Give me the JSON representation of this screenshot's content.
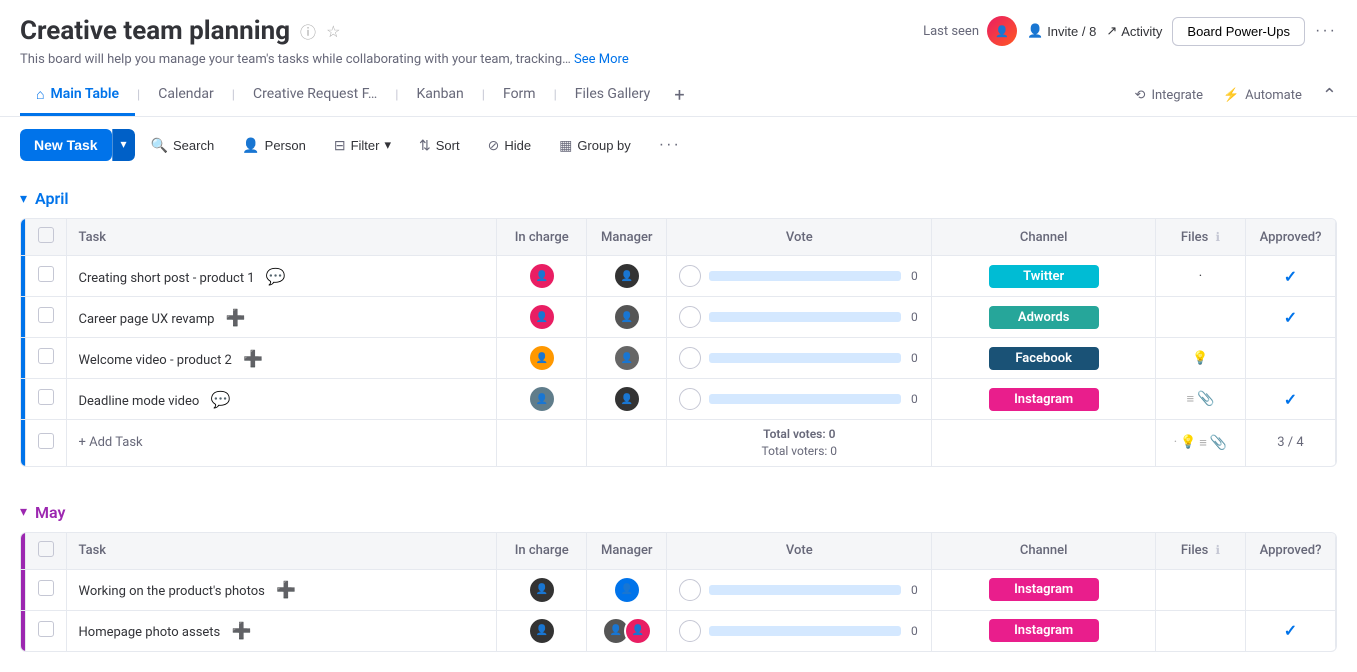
{
  "header": {
    "title": "Creative team planning",
    "subtitle": "This board will help you manage your team's tasks while collaborating with your team, tracking…",
    "see_more": "See More",
    "last_seen_label": "Last seen",
    "invite_label": "Invite / 8",
    "activity_label": "Activity",
    "power_ups_label": "Board Power-Ups"
  },
  "tabs": [
    {
      "label": "Main Table",
      "icon": "🏠",
      "active": true
    },
    {
      "label": "Calendar",
      "active": false
    },
    {
      "label": "Creative Request F…",
      "active": false
    },
    {
      "label": "Kanban",
      "active": false
    },
    {
      "label": "Form",
      "active": false
    },
    {
      "label": "Files Gallery",
      "active": false
    }
  ],
  "tab_actions": {
    "integrate": "Integrate",
    "automate": "Automate"
  },
  "toolbar": {
    "new_task": "New Task",
    "search": "Search",
    "person": "Person",
    "filter": "Filter",
    "sort": "Sort",
    "hide": "Hide",
    "group_by": "Group by"
  },
  "april_group": {
    "label": "April",
    "color": "#0073ea",
    "columns": [
      "Task",
      "In charge",
      "Manager",
      "Vote",
      "Channel",
      "Files",
      "Approved?"
    ],
    "rows": [
      {
        "task": "Creating short post - product 1",
        "in_charge_color": "#e91e63",
        "manager_color": "#333",
        "vote": 0,
        "channel": "Twitter",
        "channel_class": "channel-twitter",
        "files": "·",
        "approved": true
      },
      {
        "task": "Career page UX revamp",
        "in_charge_color": "#e91e63",
        "manager_color": "#555",
        "vote": 0,
        "channel": "Adwords",
        "channel_class": "channel-adwords",
        "files": "",
        "approved": true
      },
      {
        "task": "Welcome video - product 2",
        "in_charge_color": "#ff9800",
        "manager_color": "#666",
        "vote": 0,
        "channel": "Facebook",
        "channel_class": "channel-facebook",
        "files": "💡",
        "approved": false
      },
      {
        "task": "Deadline mode video",
        "in_charge_color": "#607d8b",
        "manager_color": "#333",
        "vote": 0,
        "channel": "Instagram",
        "channel_class": "channel-instagram",
        "files": "📎",
        "approved": true
      }
    ],
    "add_task": "+ Add Task",
    "total_votes": "Total votes: 0",
    "total_voters": "Total voters: 0",
    "approved_count": "3 / 4"
  },
  "may_group": {
    "label": "May",
    "color": "#9c27b0",
    "columns": [
      "Task",
      "In charge",
      "Manager",
      "Vote",
      "Channel",
      "Files",
      "Approved?"
    ],
    "rows": [
      {
        "task": "Working on the product's photos",
        "in_charge_color": "#333",
        "manager_color": "#0073ea",
        "vote": 0,
        "channel": "Instagram",
        "channel_class": "channel-instagram",
        "files": "",
        "approved": false
      },
      {
        "task": "Homepage photo assets",
        "in_charge_color": "#333",
        "manager_color": "#555",
        "vote": 0,
        "channel": "Instagram",
        "channel_class": "channel-instagram",
        "files": "",
        "approved": true
      }
    ]
  },
  "avatars": {
    "colors": [
      "#e91e63",
      "#ff9800",
      "#4caf50",
      "#2196f3",
      "#9c27b0",
      "#607d8b",
      "#795548",
      "#00bcd4"
    ]
  }
}
